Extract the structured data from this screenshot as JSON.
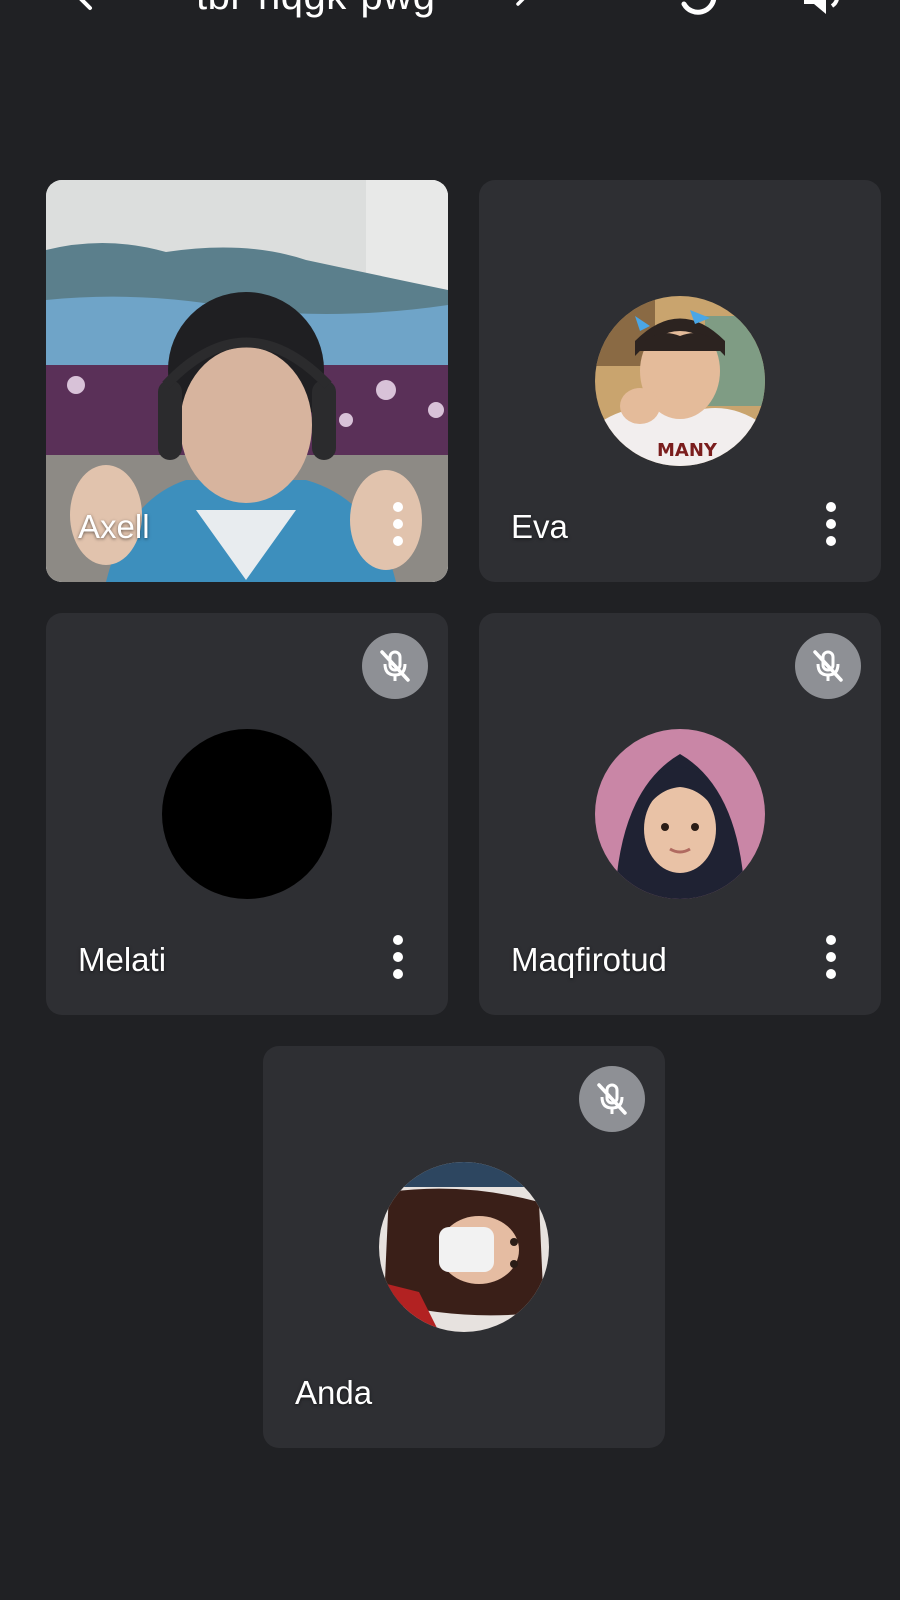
{
  "topbar": {
    "meeting_code": "tbr-nqgk-pwg",
    "back_icon": "arrow-back-icon",
    "chevron_icon": "chevron-right-icon",
    "switch_camera_icon": "switch-camera-icon",
    "speaker_icon": "speaker-icon"
  },
  "participants": [
    {
      "name": "Axell",
      "muted": false,
      "video_on": true,
      "menu_icon": "more-vert-icon"
    },
    {
      "name": "Eva",
      "muted": false,
      "video_on": false,
      "menu_icon": "more-vert-icon"
    },
    {
      "name": "Melati",
      "muted": true,
      "video_on": false,
      "menu_icon": "more-vert-icon",
      "mute_icon": "mic-off-icon"
    },
    {
      "name": "Maqfirotud",
      "muted": true,
      "video_on": false,
      "menu_icon": "more-vert-icon",
      "mute_icon": "mic-off-icon"
    },
    {
      "name": "Anda",
      "muted": true,
      "video_on": false,
      "mute_icon": "mic-off-icon"
    }
  ],
  "colors": {
    "background": "#202124",
    "tile": "#2e2f33",
    "mute_badge": "#8e9095",
    "text": "#ffffff"
  }
}
